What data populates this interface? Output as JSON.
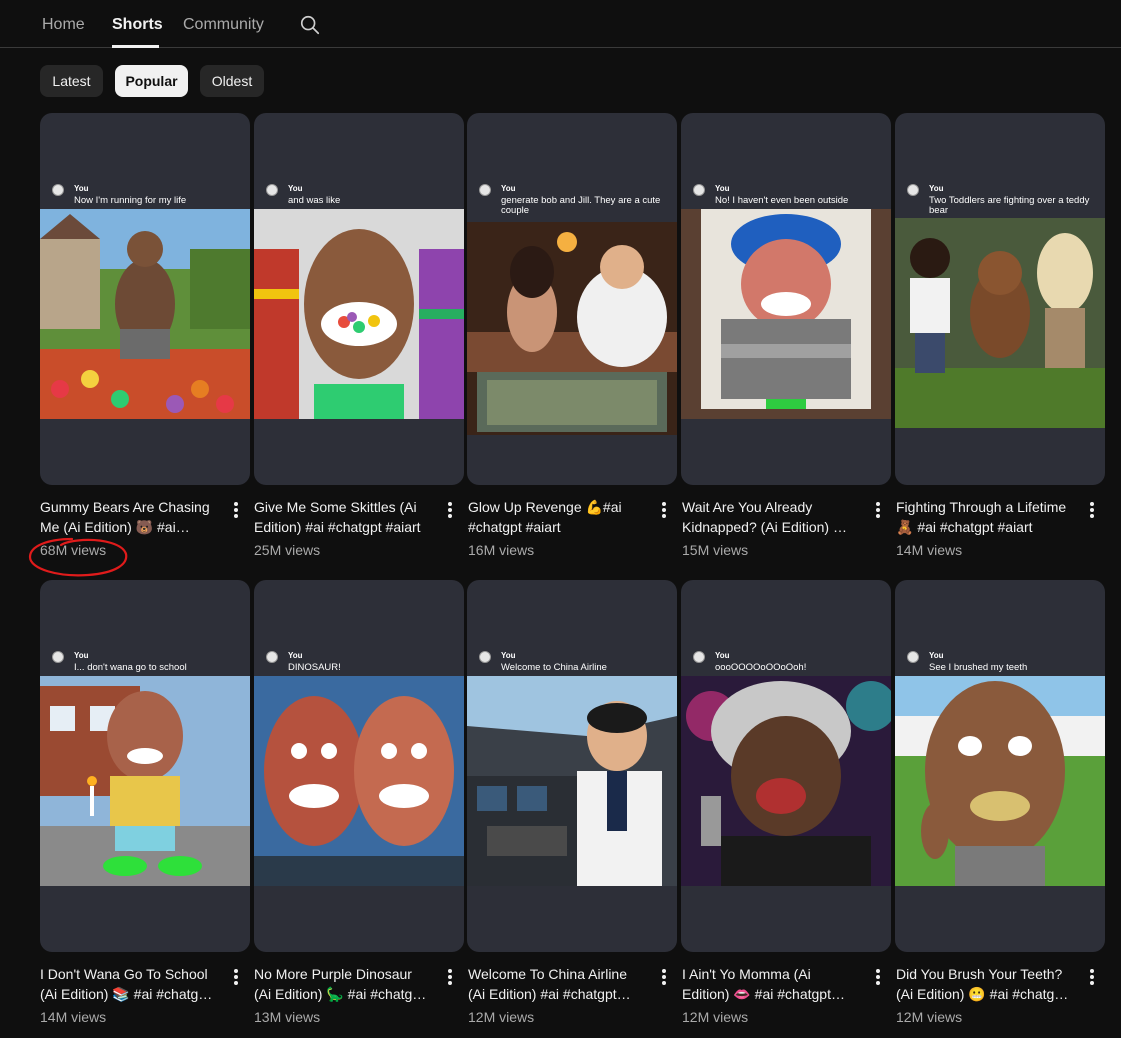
{
  "nav": {
    "tabs": [
      {
        "label": "Home"
      },
      {
        "label": "Shorts"
      },
      {
        "label": "Community"
      }
    ],
    "active_tab": "Shorts",
    "search_icon": "search-icon"
  },
  "filters": {
    "chips": [
      {
        "label": "Latest"
      },
      {
        "label": "Popular"
      },
      {
        "label": "Oldest"
      }
    ],
    "selected": "Popular"
  },
  "videos": [
    {
      "caption_user": "You",
      "caption": "Now I'm running for my life",
      "title": "Gummy Bears Are Chasing Me (Ai Edition) 🐻 #ai #chatgpt #aiart",
      "views": "68M views"
    },
    {
      "caption_user": "You",
      "caption": "and was like",
      "title": "Give Me Some Skittles (Ai Edition) #ai #chatgpt #aiart",
      "views": "25M views"
    },
    {
      "caption_user": "You",
      "caption": "generate bob and Jill. They are a cute couple",
      "title": "Glow Up Revenge 💪#ai #chatgpt #aiart",
      "views": "16M views"
    },
    {
      "caption_user": "You",
      "caption": "No! I haven't even been outside",
      "title": "Wait Are You Already Kidnapped? (Ai Edition) 😯 #ai #chatgpt #aiart",
      "views": "15M views"
    },
    {
      "caption_user": "You",
      "caption": "Two Toddlers are fighting over a teddy bear",
      "title": "Fighting Through a Lifetime 🧸 #ai #chatgpt #aiart",
      "views": "14M views"
    },
    {
      "caption_user": "You",
      "caption": "I... don't wana go to school",
      "title": "I Don't Wana Go To School (Ai Edition) 📚 #ai #chatgpt #aiart",
      "views": "14M views"
    },
    {
      "caption_user": "You",
      "caption": "DINOSAUR!",
      "title": "No More Purple Dinosaur (Ai Edition) 🦕 #ai #chatgpt #aiart",
      "views": "13M views"
    },
    {
      "caption_user": "You",
      "caption": "Welcome to China Airline",
      "title": "Welcome To China Airline (Ai Edition) #ai #chatgpt #aiart",
      "views": "12M views"
    },
    {
      "caption_user": "You",
      "caption": "oooOOOOoOOoOoh!",
      "title": "I Ain't Yo Momma (Ai Edition) 👄 #ai #chatgpt #aiart",
      "views": "12M views"
    },
    {
      "caption_user": "You",
      "caption": "See I brushed my teeth",
      "title": "Did You Brush Your Teeth? (Ai Edition) 😬 #ai #chatgpt #aiart",
      "views": "12M views"
    }
  ],
  "colors": {
    "background": "#0f0f0f",
    "card": "#2d2f38",
    "annotation": "#e01b1b"
  }
}
